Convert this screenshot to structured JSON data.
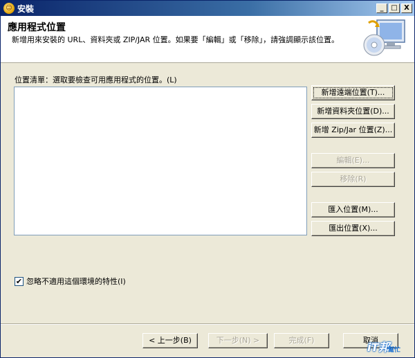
{
  "window": {
    "title": "安裝",
    "controls": [
      "_",
      "□",
      "X"
    ]
  },
  "header": {
    "title": "應用程式位置",
    "description": "新增用來安裝的 URL、資料夾或 ZIP/JAR 位置。如果要「編輯」或「移除」，請強調顯示該位置。"
  },
  "list": {
    "label": "位置清單：選取要檢查可用應用程式的位置。(L)",
    "items": []
  },
  "side_buttons": {
    "add_remote": "新增遠端位置(T)...",
    "add_folder": "新增資料夾位置(D)...",
    "add_zip": "新增 Zip/Jar 位置(Z)...",
    "edit": "編輯(E)...",
    "remove": "移除(R)",
    "import": "匯入位置(M)...",
    "export": "匯出位置(X)..."
  },
  "checkbox": {
    "label": "忽略不適用這個環境的特性(I)",
    "checked": true
  },
  "footer_buttons": {
    "back": "< 上一步(B)",
    "next": "下一步(N) >",
    "finish": "完成(F)",
    "cancel": "取消"
  },
  "watermark": {
    "text": "iT邦",
    "sub": "幫忙"
  }
}
